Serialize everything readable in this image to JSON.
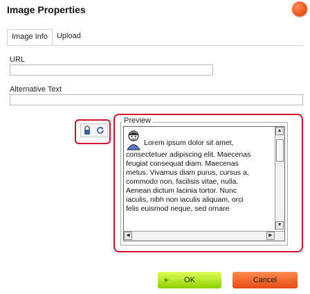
{
  "dialog": {
    "title": "Image Properties"
  },
  "tabs": [
    {
      "label": "Image Info",
      "active": true
    },
    {
      "label": "Upload",
      "active": false
    }
  ],
  "fields": {
    "url_label": "URL",
    "url_value": "",
    "alt_label": "Alternative Text",
    "alt_value": ""
  },
  "controls": {
    "lock_icon": "lock-icon",
    "reset_icon": "reset-size-icon"
  },
  "preview": {
    "legend": "Preview",
    "lines": [
      "Lorem ipsum dolor sit amet,",
      "consectetuer adipiscing elit. Maecenas",
      "feugiat consequat diam. Maecenas",
      "metus. Vivamus diam purus, cursus a,",
      "commodo non, facilisis vitae, nulla.",
      "Aenean dictum lacinia tortor. Nunc",
      "iaculis, nibh non iaculis aliquam, orci",
      "felis euismod neque, sed ornare"
    ]
  },
  "buttons": {
    "ok_label": "OK",
    "cancel_label": "Cancel"
  },
  "colors": {
    "highlight": "#d2102a",
    "ok": "#8ecf00",
    "cancel": "#e44a14"
  }
}
